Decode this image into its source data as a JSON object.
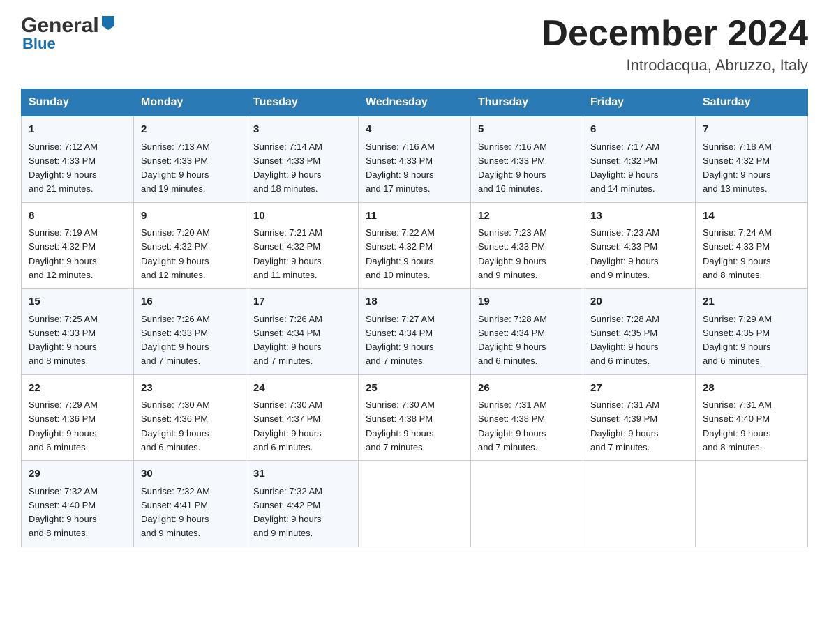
{
  "header": {
    "logo_general": "General",
    "logo_blue": "Blue",
    "month_title": "December 2024",
    "location": "Introdacqua, Abruzzo, Italy"
  },
  "days_of_week": [
    "Sunday",
    "Monday",
    "Tuesday",
    "Wednesday",
    "Thursday",
    "Friday",
    "Saturday"
  ],
  "weeks": [
    [
      {
        "num": "1",
        "sunrise": "7:12 AM",
        "sunset": "4:33 PM",
        "daylight": "9 hours and 21 minutes."
      },
      {
        "num": "2",
        "sunrise": "7:13 AM",
        "sunset": "4:33 PM",
        "daylight": "9 hours and 19 minutes."
      },
      {
        "num": "3",
        "sunrise": "7:14 AM",
        "sunset": "4:33 PM",
        "daylight": "9 hours and 18 minutes."
      },
      {
        "num": "4",
        "sunrise": "7:16 AM",
        "sunset": "4:33 PM",
        "daylight": "9 hours and 17 minutes."
      },
      {
        "num": "5",
        "sunrise": "7:16 AM",
        "sunset": "4:33 PM",
        "daylight": "9 hours and 16 minutes."
      },
      {
        "num": "6",
        "sunrise": "7:17 AM",
        "sunset": "4:32 PM",
        "daylight": "9 hours and 14 minutes."
      },
      {
        "num": "7",
        "sunrise": "7:18 AM",
        "sunset": "4:32 PM",
        "daylight": "9 hours and 13 minutes."
      }
    ],
    [
      {
        "num": "8",
        "sunrise": "7:19 AM",
        "sunset": "4:32 PM",
        "daylight": "9 hours and 12 minutes."
      },
      {
        "num": "9",
        "sunrise": "7:20 AM",
        "sunset": "4:32 PM",
        "daylight": "9 hours and 12 minutes."
      },
      {
        "num": "10",
        "sunrise": "7:21 AM",
        "sunset": "4:32 PM",
        "daylight": "9 hours and 11 minutes."
      },
      {
        "num": "11",
        "sunrise": "7:22 AM",
        "sunset": "4:32 PM",
        "daylight": "9 hours and 10 minutes."
      },
      {
        "num": "12",
        "sunrise": "7:23 AM",
        "sunset": "4:33 PM",
        "daylight": "9 hours and 9 minutes."
      },
      {
        "num": "13",
        "sunrise": "7:23 AM",
        "sunset": "4:33 PM",
        "daylight": "9 hours and 9 minutes."
      },
      {
        "num": "14",
        "sunrise": "7:24 AM",
        "sunset": "4:33 PM",
        "daylight": "9 hours and 8 minutes."
      }
    ],
    [
      {
        "num": "15",
        "sunrise": "7:25 AM",
        "sunset": "4:33 PM",
        "daylight": "9 hours and 8 minutes."
      },
      {
        "num": "16",
        "sunrise": "7:26 AM",
        "sunset": "4:33 PM",
        "daylight": "9 hours and 7 minutes."
      },
      {
        "num": "17",
        "sunrise": "7:26 AM",
        "sunset": "4:34 PM",
        "daylight": "9 hours and 7 minutes."
      },
      {
        "num": "18",
        "sunrise": "7:27 AM",
        "sunset": "4:34 PM",
        "daylight": "9 hours and 7 minutes."
      },
      {
        "num": "19",
        "sunrise": "7:28 AM",
        "sunset": "4:34 PM",
        "daylight": "9 hours and 6 minutes."
      },
      {
        "num": "20",
        "sunrise": "7:28 AM",
        "sunset": "4:35 PM",
        "daylight": "9 hours and 6 minutes."
      },
      {
        "num": "21",
        "sunrise": "7:29 AM",
        "sunset": "4:35 PM",
        "daylight": "9 hours and 6 minutes."
      }
    ],
    [
      {
        "num": "22",
        "sunrise": "7:29 AM",
        "sunset": "4:36 PM",
        "daylight": "9 hours and 6 minutes."
      },
      {
        "num": "23",
        "sunrise": "7:30 AM",
        "sunset": "4:36 PM",
        "daylight": "9 hours and 6 minutes."
      },
      {
        "num": "24",
        "sunrise": "7:30 AM",
        "sunset": "4:37 PM",
        "daylight": "9 hours and 6 minutes."
      },
      {
        "num": "25",
        "sunrise": "7:30 AM",
        "sunset": "4:38 PM",
        "daylight": "9 hours and 7 minutes."
      },
      {
        "num": "26",
        "sunrise": "7:31 AM",
        "sunset": "4:38 PM",
        "daylight": "9 hours and 7 minutes."
      },
      {
        "num": "27",
        "sunrise": "7:31 AM",
        "sunset": "4:39 PM",
        "daylight": "9 hours and 7 minutes."
      },
      {
        "num": "28",
        "sunrise": "7:31 AM",
        "sunset": "4:40 PM",
        "daylight": "9 hours and 8 minutes."
      }
    ],
    [
      {
        "num": "29",
        "sunrise": "7:32 AM",
        "sunset": "4:40 PM",
        "daylight": "9 hours and 8 minutes."
      },
      {
        "num": "30",
        "sunrise": "7:32 AM",
        "sunset": "4:41 PM",
        "daylight": "9 hours and 9 minutes."
      },
      {
        "num": "31",
        "sunrise": "7:32 AM",
        "sunset": "4:42 PM",
        "daylight": "9 hours and 9 minutes."
      },
      null,
      null,
      null,
      null
    ]
  ],
  "labels": {
    "sunrise": "Sunrise:",
    "sunset": "Sunset:",
    "daylight": "Daylight:"
  }
}
